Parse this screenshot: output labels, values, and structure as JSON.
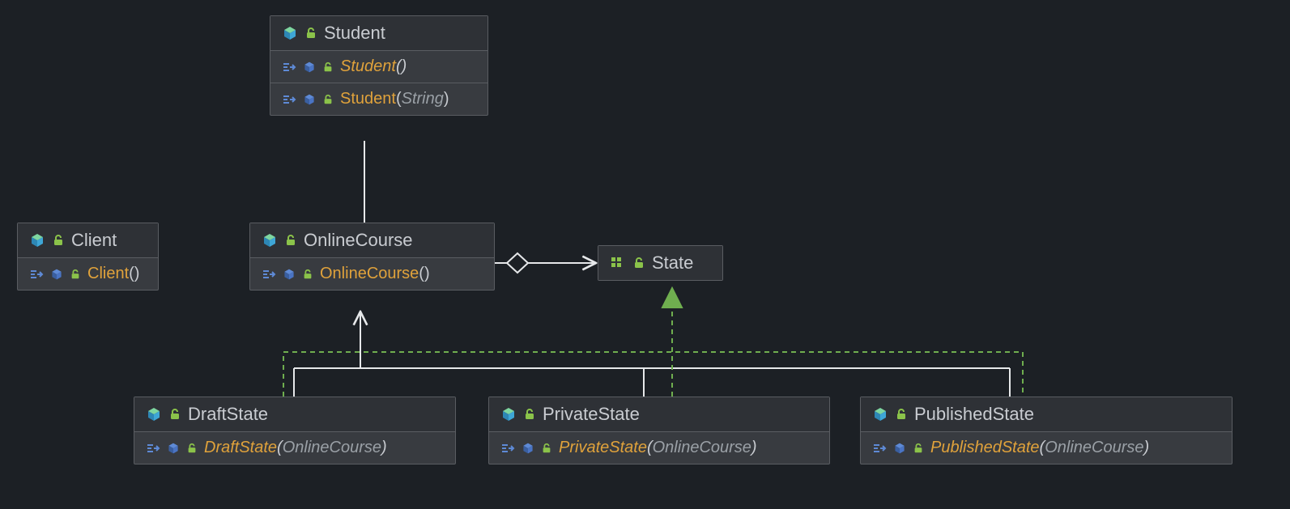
{
  "diagram": {
    "nodes": {
      "student": {
        "name": "Student",
        "kind": "class",
        "members": [
          {
            "name": "Student",
            "paramType": null,
            "italic": true
          },
          {
            "name": "Student",
            "paramType": "String",
            "italic": false
          }
        ]
      },
      "client": {
        "name": "Client",
        "kind": "class",
        "members": [
          {
            "name": "Client",
            "paramType": null,
            "italic": false
          }
        ]
      },
      "onlineCourse": {
        "name": "OnlineCourse",
        "kind": "class",
        "members": [
          {
            "name": "OnlineCourse",
            "paramType": null,
            "italic": false
          }
        ]
      },
      "state": {
        "name": "State",
        "kind": "interface",
        "members": []
      },
      "draftState": {
        "name": "DraftState",
        "kind": "class",
        "members": [
          {
            "name": "DraftState",
            "paramType": "OnlineCourse",
            "italic": true
          }
        ]
      },
      "privateState": {
        "name": "PrivateState",
        "kind": "class",
        "members": [
          {
            "name": "PrivateState",
            "paramType": "OnlineCourse",
            "italic": true
          }
        ]
      },
      "publishedState": {
        "name": "PublishedState",
        "kind": "class",
        "members": [
          {
            "name": "PublishedState",
            "paramType": "OnlineCourse",
            "italic": true
          }
        ]
      }
    },
    "relations": [
      {
        "from": "student",
        "to": "onlineCourse",
        "type": "association"
      },
      {
        "from": "onlineCourse",
        "to": "state",
        "type": "aggregation"
      },
      {
        "from": "draftState",
        "to": "onlineCourse",
        "type": "association"
      },
      {
        "from": "privateState",
        "to": "onlineCourse",
        "type": "association"
      },
      {
        "from": "publishedState",
        "to": "onlineCourse",
        "type": "association"
      },
      {
        "from": "draftState",
        "to": "state",
        "type": "realization"
      },
      {
        "from": "privateState",
        "to": "state",
        "type": "realization"
      },
      {
        "from": "publishedState",
        "to": "state",
        "type": "realization"
      }
    ],
    "colors": {
      "background": "#1c2025",
      "nodeFill": "#383b40",
      "nodeHeader": "#2e3136",
      "border": "#5a5d62",
      "text": "#c9ccd1",
      "method": "#e0a23b",
      "paramType": "#9aa0a6",
      "solidLine": "#e6e8ea",
      "realizeLine": "#6fae4f",
      "unlockIcon": "#8bc34a",
      "classIcon": "#3ea6d6",
      "classIconTop": "#7ed6a0",
      "methodArrow": "#5e8ad6"
    }
  }
}
